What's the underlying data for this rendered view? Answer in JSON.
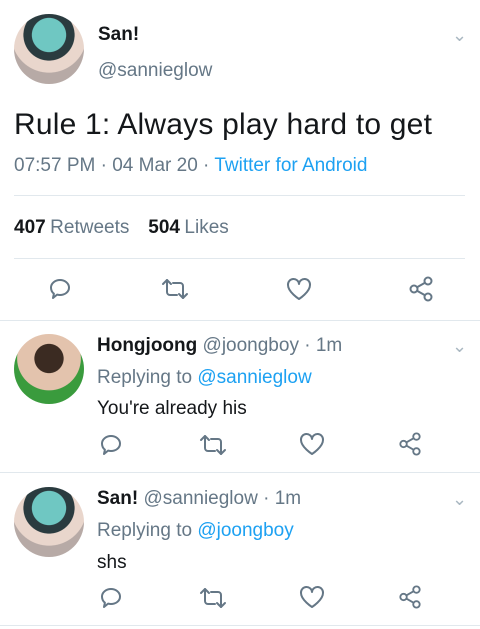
{
  "main_tweet": {
    "author_name": "San!",
    "author_handle": "@sannieglow",
    "text": "Rule 1: Always play hard to get",
    "time": "07:57 PM",
    "date": "04 Mar 20",
    "source": "Twitter for Android",
    "retweets_count": "407",
    "retweets_label": "Retweets",
    "likes_count": "504",
    "likes_label": "Likes",
    "sep": "·"
  },
  "replies": [
    {
      "author_name": "Hongjoong",
      "author_handle": "@joongboy",
      "age": "1m",
      "replying_prefix": "Replying to",
      "replying_to": "@sannieglow",
      "text": "You're already his"
    },
    {
      "author_name": "San!",
      "author_handle": "@sannieglow",
      "age": "1m",
      "replying_prefix": "Replying to",
      "replying_to": "@joongboy",
      "text": "shs"
    }
  ],
  "icons": {
    "reply": "reply-icon",
    "retweet": "retweet-icon",
    "like": "heart-icon",
    "share": "share-icon",
    "menu": "chevron-down-icon"
  },
  "colors": {
    "link": "#1da1f2",
    "secondary_text": "#657786",
    "divider": "#e1e8ed"
  }
}
